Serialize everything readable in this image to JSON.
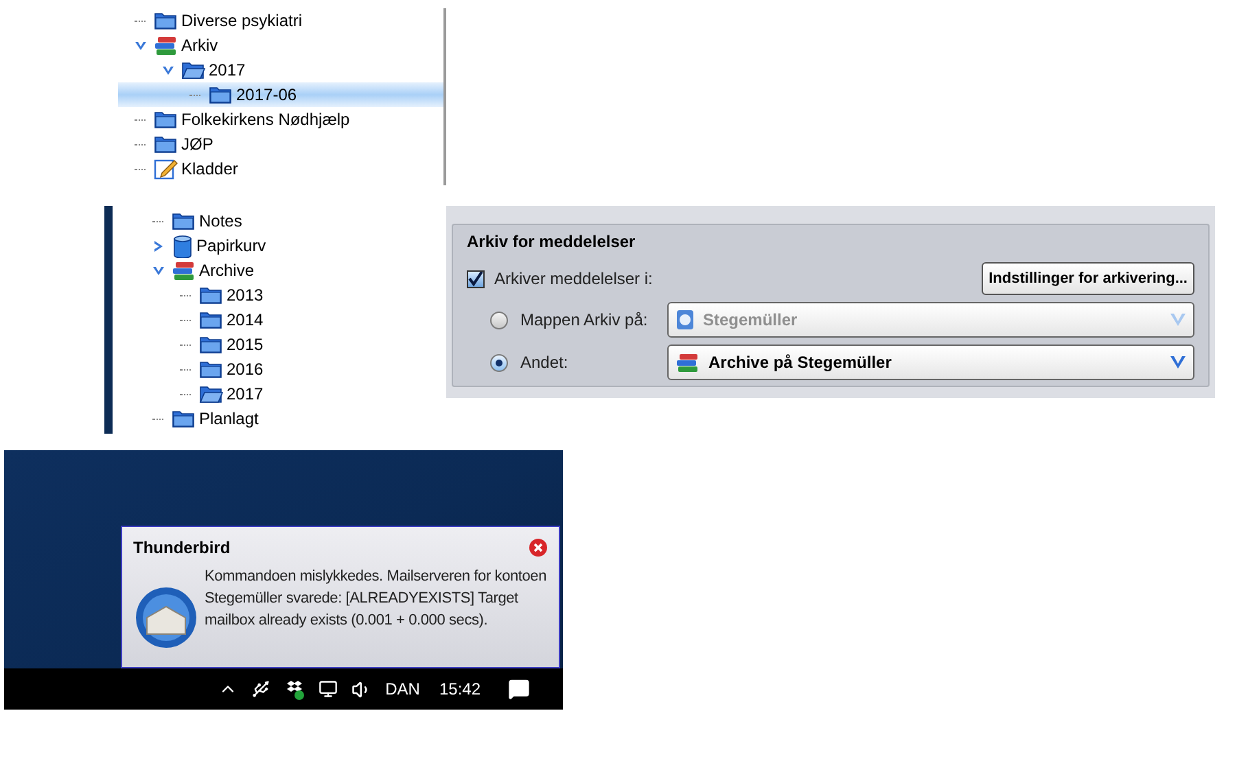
{
  "folder_tree_1": {
    "items": [
      {
        "label": "Diverse psykiatri",
        "kind": "folder",
        "selected": false
      },
      {
        "label": "Arkiv",
        "kind": "books",
        "selected": false,
        "expanded": true,
        "children": [
          {
            "label": "2017",
            "kind": "folder-open",
            "selected": false,
            "expanded": true,
            "children": [
              {
                "label": "2017-06",
                "kind": "folder",
                "selected": true
              }
            ]
          }
        ]
      },
      {
        "label": "Folkekirkens Nødhjælp",
        "kind": "folder",
        "selected": false
      },
      {
        "label": "JØP",
        "kind": "folder",
        "selected": false
      },
      {
        "label": "Kladder",
        "kind": "drafts",
        "selected": false
      }
    ]
  },
  "folder_tree_2": {
    "items": [
      {
        "label": "Notes",
        "kind": "folder"
      },
      {
        "label": "Papirkurv",
        "kind": "trash",
        "expanded": false
      },
      {
        "label": "Archive",
        "kind": "books",
        "expanded": true,
        "children": [
          {
            "label": "2013",
            "kind": "folder"
          },
          {
            "label": "2014",
            "kind": "folder"
          },
          {
            "label": "2015",
            "kind": "folder"
          },
          {
            "label": "2016",
            "kind": "folder"
          },
          {
            "label": "2017",
            "kind": "folder-open"
          }
        ]
      },
      {
        "label": "Planlagt",
        "kind": "folder"
      }
    ]
  },
  "archive_settings": {
    "title": "Arkiv for meddelelser",
    "archive_checkbox": {
      "label": "Arkiver meddelelser i:",
      "checked": true
    },
    "settings_button": "Indstillinger for arkivering...",
    "options": [
      {
        "label": "Mappen Arkiv på:",
        "selected": false,
        "value": "Stegemüller",
        "kind": "account",
        "disabled": true
      },
      {
        "label": "Andet:",
        "selected": true,
        "value": "Archive på Stegemüller",
        "kind": "books",
        "disabled": false
      }
    ]
  },
  "notification": {
    "title": "Thunderbird",
    "message": "Kommandoen mislykkedes. Mailserveren for kontoen Stegemüller svarede: [ALREADYEXISTS] Target mailbox already exists (0.001 + 0.000 secs)."
  },
  "taskbar": {
    "language": "DAN",
    "time": "15:42"
  }
}
